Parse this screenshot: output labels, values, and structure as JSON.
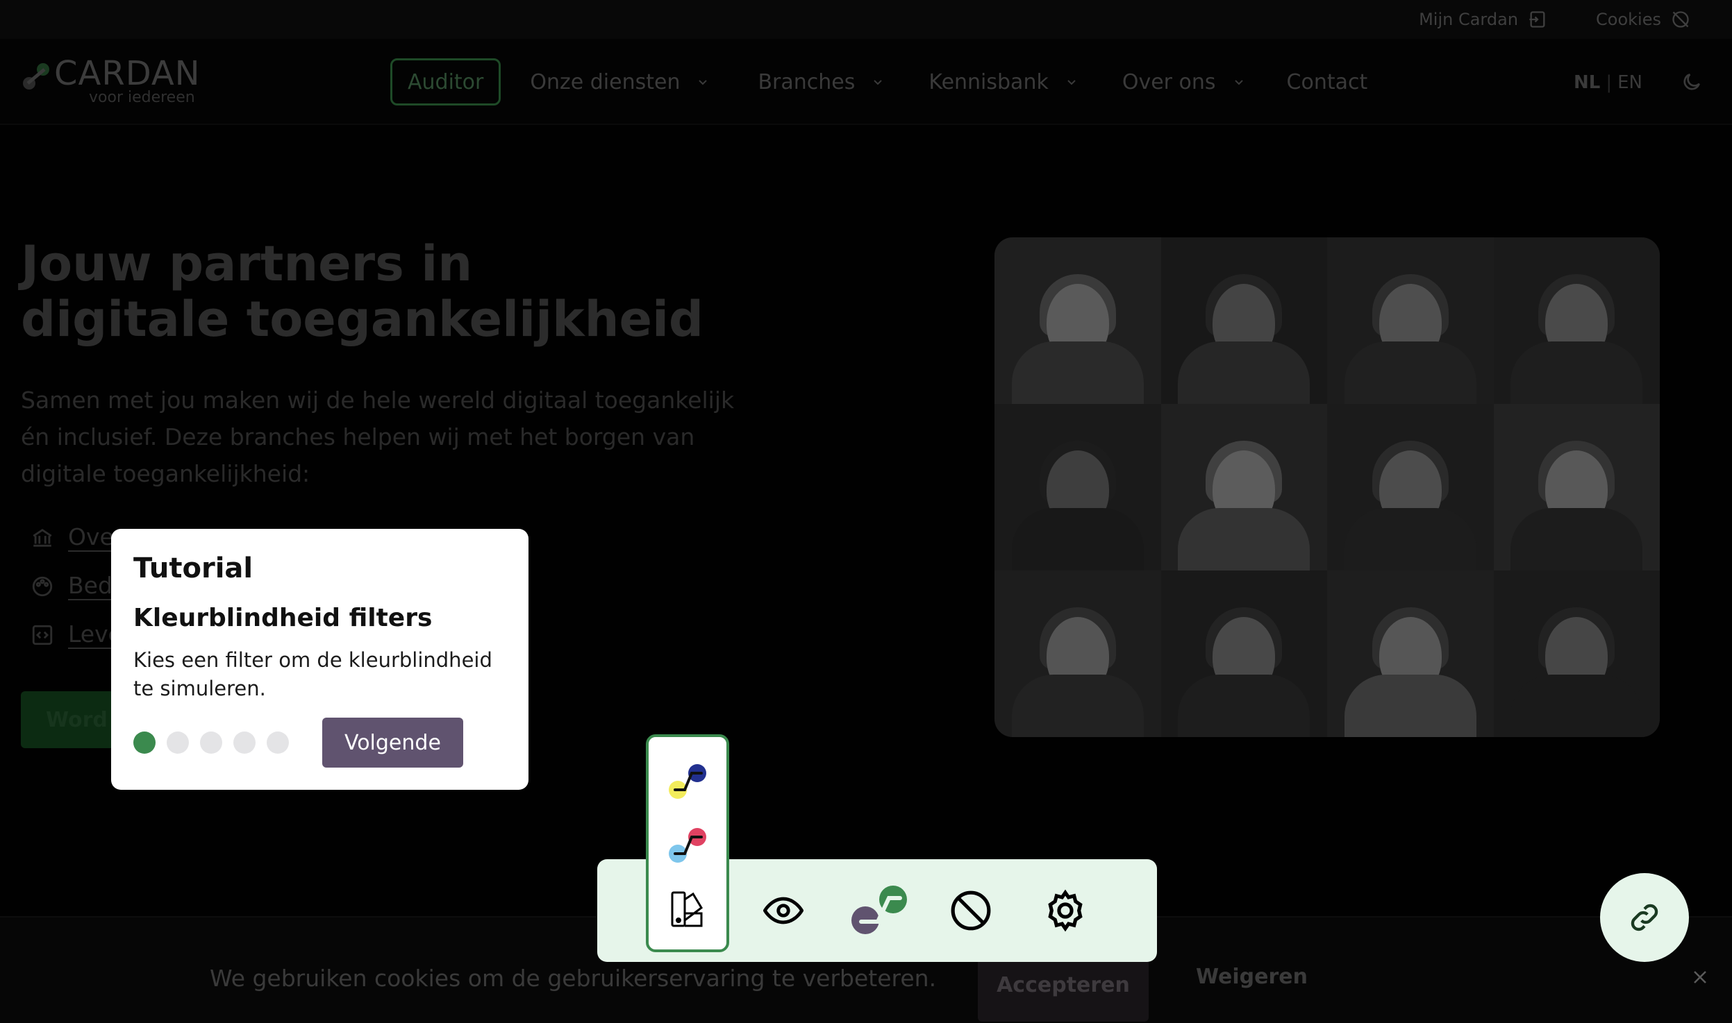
{
  "topbar": {
    "my_account": "Mijn Cardan",
    "cookies": "Cookies"
  },
  "header": {
    "logo_name": "CARDAN",
    "logo_tagline": "voor iedereen",
    "nav": {
      "auditor": "Auditor",
      "services": "Onze diensten",
      "branches": "Branches",
      "knowledge": "Kennisbank",
      "about": "Over ons",
      "contact": "Contact"
    },
    "lang_nl": "NL",
    "lang_sep": "|",
    "lang_en": "EN"
  },
  "hero": {
    "title_line1": "Jouw partners in",
    "title_line2": "digitale toegankelijkheid",
    "text": "Samen met jou maken wij de hele wereld digitaal toegankelijk én inclusief. Deze branches helpen wij met het borgen van digitale toegankelijkheid:",
    "branches": [
      "Over",
      "Bed",
      "Leve"
    ],
    "cta": "Word"
  },
  "cookie_banner": {
    "text": "We gebruiken cookies om de gebruikerservaring te verbeteren.",
    "accept": "Accepteren",
    "refuse": "Weigeren"
  },
  "tutorial": {
    "title": "Tutorial",
    "subtitle": "Kleurblindheid filters",
    "description": "Kies een filter om de kleurblindheid te simuleren.",
    "steps_total": 5,
    "step_current": 1,
    "next": "Volgende"
  },
  "colors": {
    "accent_green": "#3b8a4e",
    "button_purple": "#60536f",
    "toolbar_bg": "#e6f5ea"
  },
  "icons": {
    "toolbar": [
      "palette-icon",
      "eye-icon",
      "cardan-logo-icon",
      "block-icon",
      "gear-icon"
    ],
    "filters": [
      "filter-yellow-blue-icon",
      "filter-blue-red-icon",
      "palette-icon"
    ],
    "fab": "link-icon"
  }
}
